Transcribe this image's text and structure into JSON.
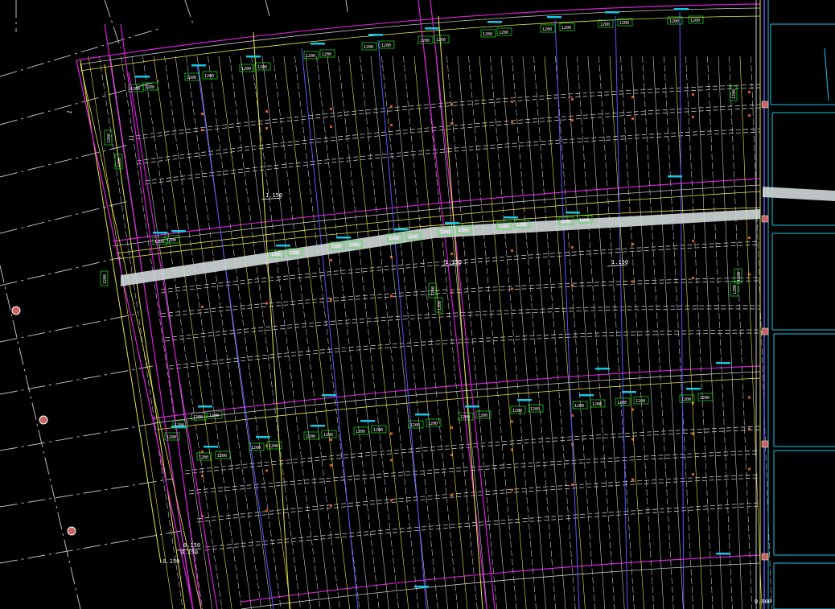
{
  "viewport": {
    "background": "#000000",
    "colors": {
      "magenta": "#d81fd8",
      "yellow": "#e8e84a",
      "blue": "#5a5aff",
      "white": "#c8c8c8",
      "cyan": "#16c8e8",
      "green": "#22e622",
      "orange": "#d85a1a",
      "strip": "#cfd8d8",
      "node": "#c86464"
    }
  },
  "elevations": {
    "upper_left": "1.150",
    "mid_left": "1.150",
    "mid_right": "1.150",
    "bottom_a": "0.150",
    "bottom_b": "0.150",
    "bottom_corner": "-0.150",
    "right_corner": "0.900"
  },
  "vertical_tag": "1",
  "dim_labels": {
    "row1": [
      "1200",
      "1200",
      "1200",
      "1200",
      "1200",
      "1200",
      "1200",
      "1200",
      "1200",
      "1200",
      "1200",
      "1200",
      "1200",
      "1200",
      "1200",
      "1200",
      "1200",
      "1200",
      "1200",
      "1200"
    ],
    "row2": [
      "1200",
      "1200",
      "1200",
      "1200",
      "1200",
      "1200",
      "1200",
      "1200",
      "1200",
      "1200",
      "1200",
      "1200",
      "1200",
      "1200"
    ],
    "row3": [
      "1200",
      "1200",
      "1200",
      "1200",
      "1200",
      "1200",
      "1200",
      "1200",
      "1200",
      "1200",
      "1200",
      "1200",
      "1200",
      "1200",
      "1200",
      "1200",
      "1200",
      "1200",
      "1200",
      "1200",
      "1200",
      "1200",
      "1200",
      "1200"
    ],
    "side": [
      "1200",
      "1200",
      "1200",
      "1200",
      "1200",
      "1200",
      "1200",
      "1200"
    ]
  }
}
